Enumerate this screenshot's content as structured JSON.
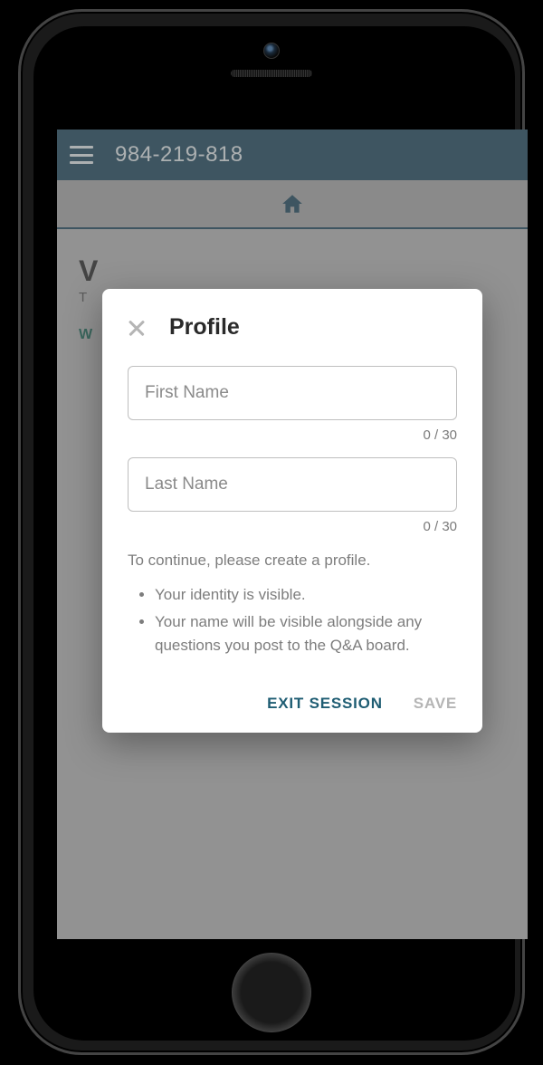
{
  "header": {
    "session_code": "984-219-818"
  },
  "background": {
    "title_partial": "V",
    "sub_partial": "T",
    "link_partial": "W"
  },
  "modal": {
    "title": "Profile",
    "first_name": {
      "placeholder": "First Name",
      "value": "",
      "counter": "0 / 30"
    },
    "last_name": {
      "placeholder": "Last Name",
      "value": "",
      "counter": "0 / 30"
    },
    "info_text": "To continue, please create a profile.",
    "bullets": [
      "Your identity is visible.",
      "Your name will be visible alongside any questions you post to the Q&A board."
    ],
    "actions": {
      "exit": "EXIT SESSION",
      "save": "SAVE"
    }
  }
}
